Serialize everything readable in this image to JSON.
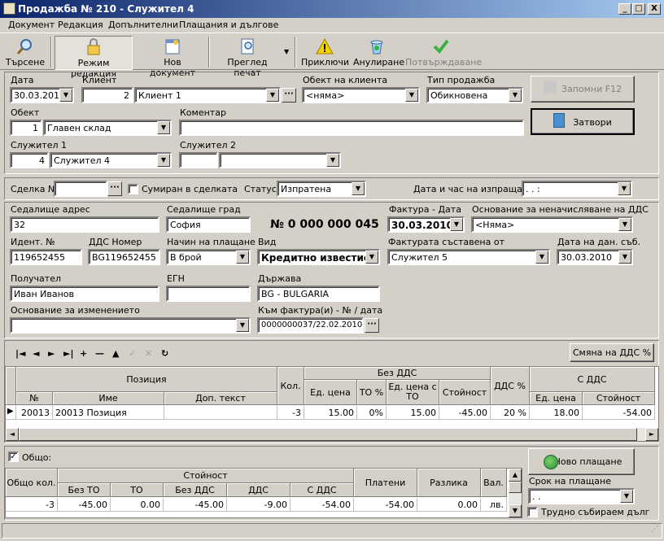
{
  "window": {
    "title": "Продажба № 210 - Служител 4",
    "min": "_",
    "max": "□",
    "close": "X"
  },
  "menu": [
    "Документ",
    "Редакция",
    "Допълнителни",
    "Плащания и дългове"
  ],
  "toolbar": {
    "search": "Търсене",
    "edit": "Режим редакция",
    "newdoc": "Нов документ",
    "preview": "Преглед печат",
    "finish": "Приключи",
    "cancel": "Анулиране",
    "confirm": "Потвърждаване"
  },
  "icons": {
    "search": "magnifier-icon",
    "edit": "lock-icon",
    "newdoc": "new-document-icon",
    "preview": "print-preview-icon",
    "finish": "warning-icon",
    "cancel": "recycle-bin-icon",
    "confirm": "checkmark-icon"
  },
  "header": {
    "date_label": "Дата",
    "date": "30.03.2010",
    "client_label": "Клиент",
    "client_id": "2",
    "client_name": "Клиент 1",
    "client_obj_label": "Обект на клиента",
    "client_obj": "<няма>",
    "sale_type_label": "Тип продажба",
    "sale_type": "Обикновена",
    "object_label": "Обект",
    "object_id": "1",
    "object_name": "Главен склад",
    "comment_label": "Коментар",
    "comment": "",
    "emp1_label": "Служител 1",
    "emp1_id": "4",
    "emp1_name": "Служител 4",
    "emp2_label": "Служител 2",
    "emp2_id": "",
    "emp2_name": "",
    "save_btn": "Запомни  F12",
    "close_btn": "Затвори"
  },
  "deal": {
    "deal_label": "Сделка №",
    "deal_value": "",
    "summed_label": "Сумиран в сделката",
    "status_label": "Статус",
    "status": "Изпратена",
    "send_label": "Дата и час на изпращане",
    "send_value": " .  .       :  "
  },
  "invoice": {
    "addr_label": "Седалище адрес",
    "addr": "32",
    "city_label": "Седалище град",
    "city": "София",
    "number": "№ 0 000 000 045",
    "inv_date_label": "Фактура - Дата",
    "inv_date": "30.03.2010",
    "vat_basis_label": "Основание за неначисляване на ДДС",
    "vat_basis": "<Няма>",
    "ident_label": "Идент. №",
    "ident": "119652455",
    "vat_no_label": "ДДС Номер",
    "vat_no": "BG119652455",
    "pay_label": "Начин на плащане",
    "pay": "В брой",
    "type_label": "Вид",
    "type": "Кредитно известие",
    "made_by_label": "Фактурата съставена от",
    "made_by": "Служител 5",
    "tax_date_label": "Дата на дан. съб.",
    "tax_date": "30.03.2010",
    "recipient_label": "Получател",
    "recipient": "Иван Иванов",
    "egn_label": "ЕГН",
    "egn": "",
    "country_label": "Държава",
    "country": "BG - BULGARIA",
    "reason_label": "Основание за изменението",
    "reason": "",
    "to_inv_label": "Към фактура(и) - № / дата",
    "to_inv": "0000000037/22.02.2010;"
  },
  "items": {
    "change_vat_btn": "Смяна на ДДС %",
    "nav": [
      "|◄",
      "◄",
      "►",
      "►|",
      "+",
      "—",
      "▲",
      "✓",
      "✕",
      "↻"
    ],
    "headers": {
      "position": "Позиция",
      "no": "№",
      "name": "Име",
      "extra": "Доп. текст",
      "qty": "Кол.",
      "without_vat": "Без ДДС",
      "unit_price": "Ед. цена",
      "to_pct": "ТО %",
      "unit_price_to": "Ед. цена с ТО",
      "value": "Стойност",
      "vat_pct": "ДДС %",
      "with_vat": "С ДДС",
      "unit_price2": "Ед. цена",
      "value2": "Стойност"
    },
    "rows": [
      {
        "marker": "▶",
        "no": "20013",
        "name": "20013 Позиция",
        "extra": "",
        "qty": "-3",
        "unit_price": "15.00",
        "to_pct": "0%",
        "unit_price_to": "15.00",
        "value": "-45.00",
        "vat_pct": "20 %",
        "unit_price2": "18.00",
        "value2": "-54.00"
      }
    ]
  },
  "totals": {
    "total_label": "Общо:",
    "headers": {
      "qty": "Общо кол.",
      "value": "Стойност",
      "no_to": "Без ТО",
      "to": "ТО",
      "no_vat": "Без ДДС",
      "vat": "ДДС",
      "with_vat": "С ДДС",
      "paid": "Платени",
      "diff": "Разлика",
      "cur": "Вал."
    },
    "row": {
      "qty": "-3",
      "no_to": "-45.00",
      "to": "0.00",
      "no_vat": "-45.00",
      "vat": "-9.00",
      "with_vat": "-54.00",
      "paid": "-54.00",
      "diff": "0.00",
      "cur": "лв."
    },
    "new_payment": "Ново плащане",
    "term_label": "Срок на плащане",
    "term": " .  .",
    "bad_debt": "Трудно събираем дълг"
  },
  "colors": {
    "title_start": "#0a246a",
    "title_end": "#a6caf0",
    "face": "#d4d0c8"
  }
}
